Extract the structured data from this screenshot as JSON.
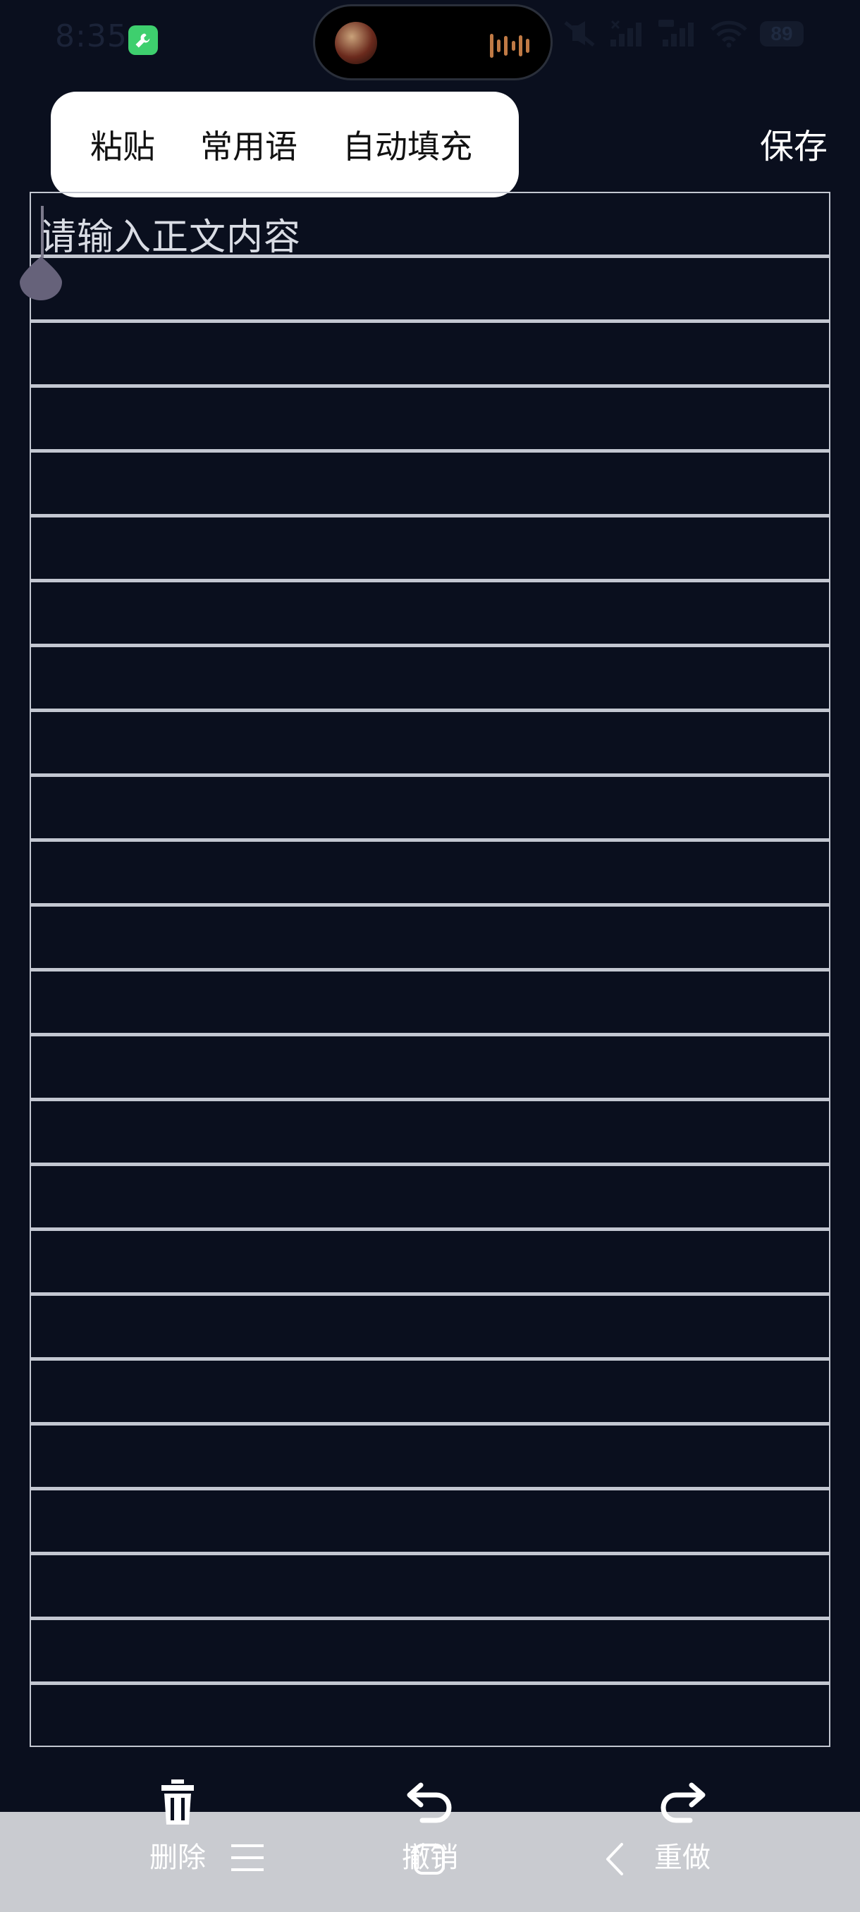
{
  "status_bar": {
    "time": "8:35",
    "battery": "89"
  },
  "context_menu": {
    "items": [
      "粘贴",
      "常用语",
      "自动填充"
    ]
  },
  "header": {
    "save_label": "保存"
  },
  "editor": {
    "placeholder": "请输入正文内容"
  },
  "toolbar": {
    "delete_label": "删除",
    "undo_label": "撤销",
    "redo_label": "重做"
  }
}
